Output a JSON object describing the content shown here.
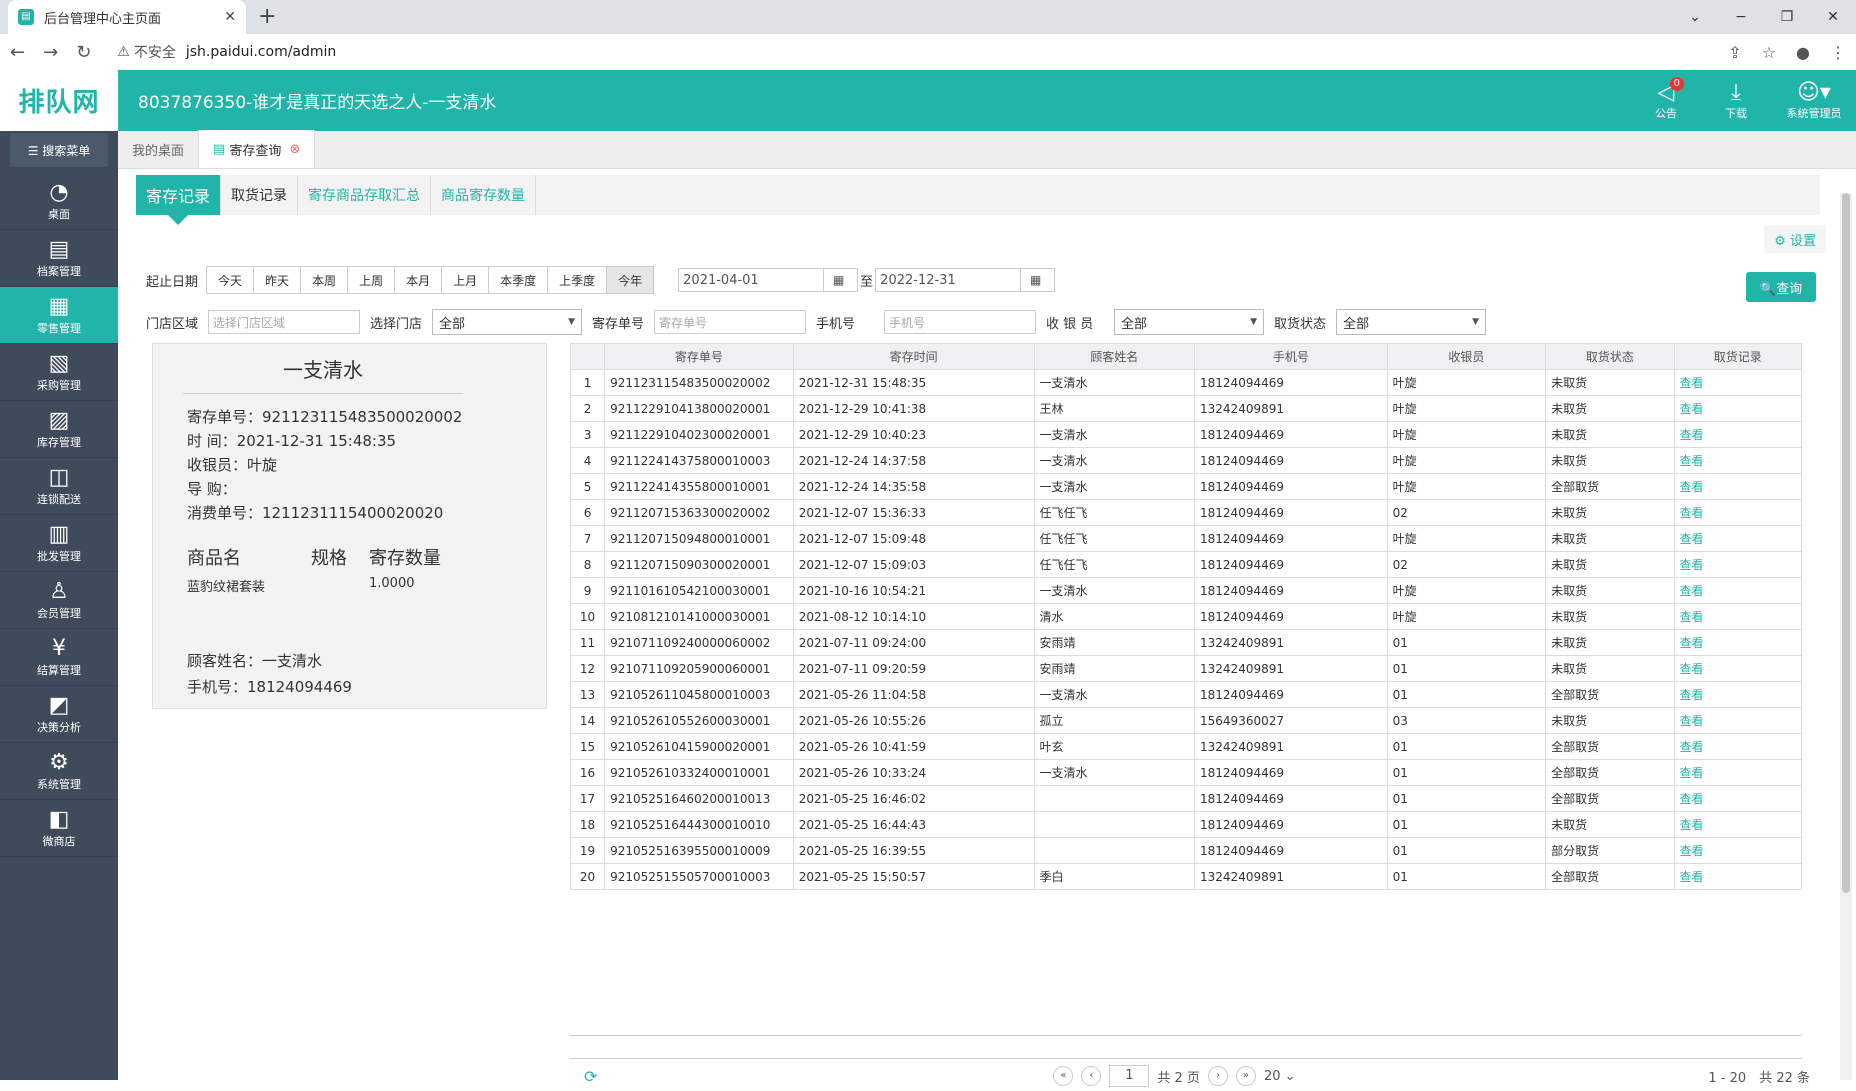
{
  "browser": {
    "tab_title": "后台管理中心主页面",
    "tab_close": "✕",
    "new_tab": "+",
    "back": "←",
    "forward": "→",
    "reload": "↻",
    "insecure_label": "不安全",
    "warn_icon": "⚠",
    "url": "jsh.paidui.com/admin",
    "win_min": "−",
    "win_restore": "❐",
    "win_close": "✕",
    "win_chevron": "⌄"
  },
  "header": {
    "logo": "排队网",
    "title": "8037876350-谁才是真正的天选之人-一支清水",
    "announce_label": "公告",
    "announce_badge": "0",
    "download_label": "下载",
    "user_label": "系统管理员"
  },
  "sidebar": {
    "search_label": "☰ 搜索菜单",
    "items": [
      {
        "label": "桌面",
        "icon": "◔"
      },
      {
        "label": "档案管理",
        "icon": "▤"
      },
      {
        "label": "零售管理",
        "icon": "▦"
      },
      {
        "label": "采购管理",
        "icon": "▧"
      },
      {
        "label": "库存管理",
        "icon": "▨"
      },
      {
        "label": "连锁配送",
        "icon": "◫"
      },
      {
        "label": "批发管理",
        "icon": "▥"
      },
      {
        "label": "会员管理",
        "icon": "♙"
      },
      {
        "label": "结算管理",
        "icon": "¥"
      },
      {
        "label": "决策分析",
        "icon": "◩"
      },
      {
        "label": "系统管理",
        "icon": "⚙"
      },
      {
        "label": "微商店",
        "icon": "◧"
      }
    ]
  },
  "page_tabs": {
    "desktop": "我的桌面",
    "current": "寄存查询",
    "close": "⊗"
  },
  "sub_tabs": [
    "寄存记录",
    "取货记录",
    "寄存商品存取汇总",
    "商品寄存数量"
  ],
  "settings_label": "⚙ 设置",
  "filters": {
    "date_label": "起止日期",
    "quick": [
      "今天",
      "昨天",
      "本周",
      "上周",
      "本月",
      "上月",
      "本季度",
      "上季度",
      "今年"
    ],
    "start_date": "2021-04-01",
    "end_date": "2022-12-31",
    "to": "至",
    "cal_icon": "▦",
    "search_btn": "🔍查询",
    "store_area_label": "门店区域",
    "store_area_ph": "选择门店区域",
    "store_label": "选择门店",
    "store_val": "全部",
    "order_label": "寄存单号",
    "order_ph": "寄存单号",
    "phone_label": "手机号",
    "phone_ph": "手机号",
    "cashier_label": "收 银 员",
    "cashier_val": "全部",
    "status_label": "取货状态",
    "status_val": "全部"
  },
  "detail": {
    "name": "一支清水",
    "order": "寄存单号：921123115483500020002",
    "time": "时 间：2021-12-31 15:48:35",
    "cashier": "收银员：叶旋",
    "guide": "导 购：",
    "consume": "消费单号：1211231115400020020",
    "col_name": "商品名",
    "col_spec": "规格",
    "col_qty": "寄存数量",
    "item_name": "蓝豹纹裙套装",
    "item_qty": "1.0000",
    "customer": "顾客姓名：一支清水",
    "phone": "手机号：18124094469"
  },
  "table": {
    "headers": [
      "",
      "寄存单号",
      "寄存时间",
      "顾客姓名",
      "手机号",
      "收银员",
      "取货状态",
      "取货记录"
    ],
    "link": "查看",
    "rows": [
      [
        "1",
        "921123115483500020002",
        "2021-12-31 15:48:35",
        "一支清水",
        "18124094469",
        "叶旋",
        "未取货"
      ],
      [
        "2",
        "921122910413800020001",
        "2021-12-29 10:41:38",
        "王林",
        "13242409891",
        "叶旋",
        "未取货"
      ],
      [
        "3",
        "921122910402300020001",
        "2021-12-29 10:40:23",
        "一支清水",
        "18124094469",
        "叶旋",
        "未取货"
      ],
      [
        "4",
        "921122414375800010003",
        "2021-12-24 14:37:58",
        "一支清水",
        "18124094469",
        "叶旋",
        "未取货"
      ],
      [
        "5",
        "921122414355800010001",
        "2021-12-24 14:35:58",
        "一支清水",
        "18124094469",
        "叶旋",
        "全部取货"
      ],
      [
        "6",
        "921120715363300020002",
        "2021-12-07 15:36:33",
        "任飞任飞",
        "18124094469",
        "02",
        "未取货"
      ],
      [
        "7",
        "921120715094800010001",
        "2021-12-07 15:09:48",
        "任飞任飞",
        "18124094469",
        "叶旋",
        "未取货"
      ],
      [
        "8",
        "921120715090300020001",
        "2021-12-07 15:09:03",
        "任飞任飞",
        "18124094469",
        "02",
        "未取货"
      ],
      [
        "9",
        "921101610542100030001",
        "2021-10-16 10:54:21",
        "一支清水",
        "18124094469",
        "叶旋",
        "未取货"
      ],
      [
        "10",
        "921081210141000030001",
        "2021-08-12 10:14:10",
        "清水",
        "18124094469",
        "叶旋",
        "未取货"
      ],
      [
        "11",
        "921071109240000060002",
        "2021-07-11 09:24:00",
        "安雨靖",
        "13242409891",
        "01",
        "未取货"
      ],
      [
        "12",
        "921071109205900060001",
        "2021-07-11 09:20:59",
        "安雨靖",
        "13242409891",
        "01",
        "未取货"
      ],
      [
        "13",
        "921052611045800010003",
        "2021-05-26 11:04:58",
        "一支清水",
        "18124094469",
        "01",
        "全部取货"
      ],
      [
        "14",
        "921052610552600030001",
        "2021-05-26 10:55:26",
        "孤立",
        "15649360027",
        "03",
        "未取货"
      ],
      [
        "15",
        "921052610415900020001",
        "2021-05-26 10:41:59",
        "叶玄",
        "13242409891",
        "01",
        "全部取货"
      ],
      [
        "16",
        "921052610332400010001",
        "2021-05-26 10:33:24",
        "一支清水",
        "18124094469",
        "01",
        "全部取货"
      ],
      [
        "17",
        "921052516460200010013",
        "2021-05-25 16:46:02",
        "",
        "18124094469",
        "01",
        "全部取货"
      ],
      [
        "18",
        "921052516444300010010",
        "2021-05-25 16:44:43",
        "",
        "18124094469",
        "01",
        "未取货"
      ],
      [
        "19",
        "921052516395500010009",
        "2021-05-25 16:39:55",
        "",
        "18124094469",
        "01",
        "部分取货"
      ],
      [
        "20",
        "921052515505700010003",
        "2021-05-25 15:50:57",
        "季白",
        "13242409891",
        "01",
        "全部取货"
      ]
    ]
  },
  "pager": {
    "refresh": "⟳",
    "first": "«",
    "prev": "‹",
    "next": "›",
    "last": "»",
    "page": "1",
    "total_pages": "共 2 页",
    "page_size": "20 ⌄",
    "info": "1 - 20　共 22 条"
  },
  "colors": {
    "accent": "#21b5a9",
    "sidebar": "#3f4b5a"
  }
}
